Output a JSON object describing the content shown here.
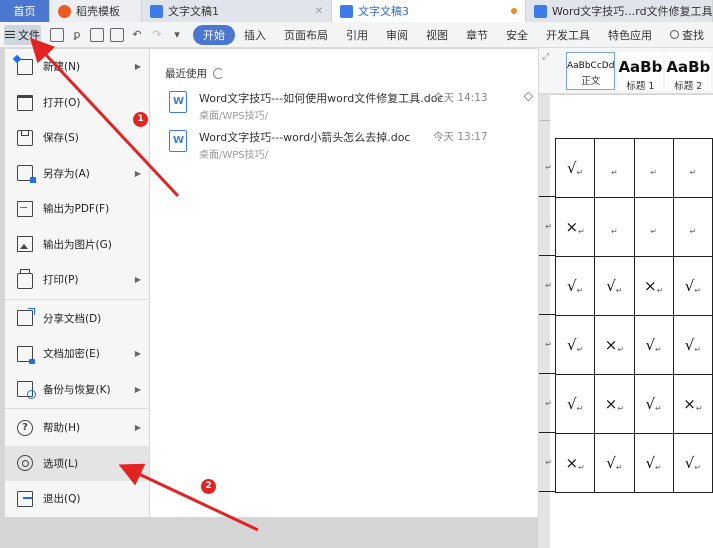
{
  "tabs": [
    {
      "label": "首页",
      "kind": "home"
    },
    {
      "label": "稻壳模板",
      "kind": "daoke",
      "color": "#ee5a24"
    },
    {
      "label": "文字文稿1",
      "kind": "doc"
    },
    {
      "label": "文字文稿3",
      "kind": "doc-active"
    },
    {
      "label": "Word文字技巧…rd文件修复工具",
      "kind": "doc"
    }
  ],
  "toolbar": {
    "file_label": "文件",
    "ribbon_tabs": [
      "开始",
      "插入",
      "页面布局",
      "引用",
      "审阅",
      "视图",
      "章节",
      "安全",
      "开发工具",
      "特色应用"
    ],
    "active_tab": "开始",
    "search_label": "查找"
  },
  "styles": [
    {
      "sample": "AaBbCcDd",
      "label": "正文"
    },
    {
      "sample": "AaBb",
      "label": "标题 1"
    },
    {
      "sample": "AaBb",
      "label": "标题 2"
    }
  ],
  "menu": {
    "items": [
      {
        "label": "新建(N)",
        "icon": "new-doc-icon",
        "has_submenu": true
      },
      {
        "label": "打开(O)",
        "icon": "folder-icon",
        "has_submenu": false
      },
      {
        "label": "保存(S)",
        "icon": "save-icon",
        "has_submenu": false
      },
      {
        "label": "另存为(A)",
        "icon": "save-as-icon",
        "has_submenu": true
      },
      {
        "label": "输出为PDF(F)",
        "icon": "pdf-icon",
        "has_submenu": false
      },
      {
        "label": "输出为图片(G)",
        "icon": "image-icon",
        "has_submenu": false
      },
      {
        "label": "打印(P)",
        "icon": "printer-icon",
        "has_submenu": true
      },
      {
        "label": "分享文档(D)",
        "icon": "share-icon",
        "has_submenu": false
      },
      {
        "label": "文档加密(E)",
        "icon": "lock-icon",
        "has_submenu": true
      },
      {
        "label": "备份与恢复(K)",
        "icon": "backup-icon",
        "has_submenu": true
      },
      {
        "label": "帮助(H)",
        "icon": "help-icon",
        "has_submenu": true
      },
      {
        "label": "选项(L)",
        "icon": "gear-icon",
        "has_submenu": false
      },
      {
        "label": "退出(Q)",
        "icon": "exit-icon",
        "has_submenu": false
      }
    ],
    "highlighted": "选项(L)"
  },
  "recent": {
    "title": "最近使用",
    "files": [
      {
        "name": "Word文字技巧---如何使用word文件修复工具.doc",
        "path": "桌面/WPS技巧/",
        "time": "今天 14:13",
        "pinned_icon": true
      },
      {
        "name": "Word文字技巧---word小箭头怎么去掉.doc",
        "path": "桌面/WPS技巧/",
        "time": "今天 13:17",
        "pinned_icon": false
      }
    ]
  },
  "document": {
    "table_rows": [
      [
        "√",
        "",
        "",
        ""
      ],
      [
        "×",
        "",
        "",
        ""
      ],
      [
        "√",
        "√",
        "×",
        "√"
      ],
      [
        "√",
        "×",
        "√",
        "√"
      ],
      [
        "√",
        "×",
        "√",
        "×"
      ],
      [
        "×",
        "√",
        "√",
        "√"
      ]
    ],
    "return_mark": "↵"
  },
  "annotations": [
    {
      "label": "1"
    },
    {
      "label": "2"
    }
  ],
  "colors": {
    "accent": "#4b77d1",
    "annotation_red": "#e32222",
    "word_blue": "#3d7be8"
  }
}
